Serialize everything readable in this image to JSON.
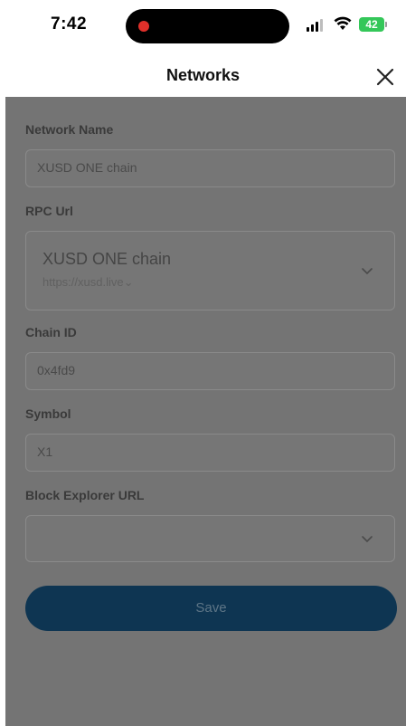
{
  "status_bar": {
    "time": "7:42",
    "battery": "42"
  },
  "header": {
    "title": "Networks"
  },
  "form": {
    "network_name": {
      "label": "Network Name",
      "value": "XUSD ONE chain"
    },
    "rpc_url": {
      "label": "RPC Url",
      "name": "XUSD ONE chain",
      "url": "https://xusd.live⌄"
    },
    "chain_id": {
      "label": "Chain ID",
      "value": "0x4fd9"
    },
    "symbol": {
      "label": "Symbol",
      "value": "X1"
    },
    "block_explorer": {
      "label": "Block Explorer URL",
      "value": ""
    },
    "save_label": "Save"
  },
  "colors": {
    "overlay": "#747474",
    "save_button": "#0e3552",
    "battery": "#34c759",
    "record_dot": "#e0302a"
  },
  "icons": [
    "signal-icon",
    "wifi-icon",
    "battery-icon",
    "close-icon",
    "chevron-down-icon"
  ]
}
